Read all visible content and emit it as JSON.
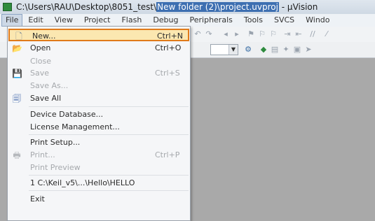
{
  "window": {
    "title_prefix": "C:\\Users\\RAU\\Desktop\\8051_test\\",
    "title_highlight": "New folder (2)\\project.uvproj",
    "title_suffix": " - µVision"
  },
  "menubar": [
    "File",
    "Edit",
    "View",
    "Project",
    "Flash",
    "Debug",
    "Peripherals",
    "Tools",
    "SVCS",
    "Windo"
  ],
  "file_menu": [
    {
      "label": "New...",
      "shortcut": "Ctrl+N",
      "icon": "new-file-icon",
      "glyph": "🗋",
      "enabled": true,
      "selected": true
    },
    {
      "label": "Open",
      "shortcut": "Ctrl+O",
      "icon": "open-folder-icon",
      "glyph": "📂",
      "enabled": true
    },
    {
      "label": "Close",
      "shortcut": "",
      "icon": "",
      "glyph": "",
      "enabled": false
    },
    {
      "label": "Save",
      "shortcut": "Ctrl+S",
      "icon": "save-icon",
      "glyph": "💾",
      "enabled": false
    },
    {
      "label": "Save As...",
      "shortcut": "",
      "icon": "",
      "glyph": "",
      "enabled": false
    },
    {
      "label": "Save All",
      "shortcut": "",
      "icon": "save-all-icon",
      "glyph": "🗐",
      "enabled": true
    },
    {
      "label": "Device Database...",
      "shortcut": "",
      "icon": "",
      "glyph": "",
      "enabled": true
    },
    {
      "label": "License Management...",
      "shortcut": "",
      "icon": "",
      "glyph": "",
      "enabled": true
    },
    {
      "label": "Print Setup...",
      "shortcut": "",
      "icon": "",
      "glyph": "",
      "enabled": true
    },
    {
      "label": "Print...",
      "shortcut": "Ctrl+P",
      "icon": "print-icon",
      "glyph": "🖶",
      "enabled": false
    },
    {
      "label": "Print Preview",
      "shortcut": "",
      "icon": "",
      "glyph": "",
      "enabled": false
    },
    {
      "label": "1 C:\\Keil_v5\\...\\Hello\\HELLO",
      "shortcut": "",
      "icon": "",
      "glyph": "",
      "enabled": true
    },
    {
      "label": "Exit",
      "shortcut": "",
      "icon": "",
      "glyph": "",
      "enabled": true
    }
  ],
  "colors": {
    "highlight_border": "#e07a1a",
    "highlight_fill": "#fbe7b0"
  }
}
